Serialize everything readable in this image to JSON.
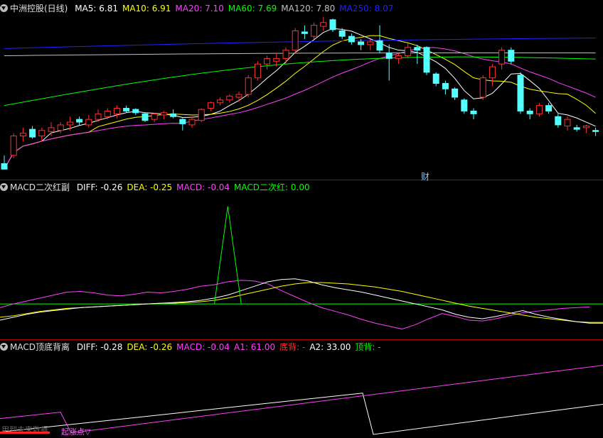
{
  "chart_data": [
    {
      "type": "candlestick",
      "panel": "main",
      "title": "中洲控股(日线)",
      "indicators": [
        {
          "name": "MA5",
          "value": "6.81",
          "color": "#ffffff"
        },
        {
          "name": "MA10",
          "value": "6.91",
          "color": "#ffff00"
        },
        {
          "name": "MA20",
          "value": "7.10",
          "color": "#ff40ff"
        },
        {
          "name": "MA60",
          "value": "7.69",
          "color": "#00ff00"
        },
        {
          "name": "MA120",
          "value": "7.80",
          "color": "#c0c0c0"
        },
        {
          "name": "MA250",
          "value": "8.07",
          "color": "#2020ff"
        }
      ],
      "ylim": [
        5.55,
        8.5
      ],
      "candles": [
        [
          5.8,
          5.95,
          5.7,
          5.7
        ],
        [
          5.95,
          6.35,
          5.9,
          6.3
        ],
        [
          6.3,
          6.45,
          6.2,
          6.35
        ],
        [
          6.42,
          6.48,
          6.25,
          6.28
        ],
        [
          6.3,
          6.45,
          6.2,
          6.4
        ],
        [
          6.38,
          6.55,
          6.3,
          6.45
        ],
        [
          6.4,
          6.55,
          6.35,
          6.5
        ],
        [
          6.5,
          6.65,
          6.4,
          6.55
        ],
        [
          6.6,
          6.65,
          6.5,
          6.55
        ],
        [
          6.5,
          6.68,
          6.45,
          6.6
        ],
        [
          6.6,
          6.78,
          6.55,
          6.7
        ],
        [
          6.65,
          6.8,
          6.6,
          6.75
        ],
        [
          6.7,
          6.85,
          6.62,
          6.8
        ],
        [
          6.8,
          6.85,
          6.72,
          6.75
        ],
        [
          6.78,
          6.8,
          6.68,
          6.72
        ],
        [
          6.7,
          6.72,
          6.55,
          6.58
        ],
        [
          6.6,
          6.72,
          6.55,
          6.7
        ],
        [
          6.68,
          6.75,
          6.6,
          6.72
        ],
        [
          6.7,
          6.78,
          6.62,
          6.65
        ],
        [
          6.6,
          6.62,
          6.4,
          6.52
        ],
        [
          6.5,
          6.65,
          6.45,
          6.6
        ],
        [
          6.58,
          6.8,
          6.55,
          6.78
        ],
        [
          6.8,
          6.92,
          6.75,
          6.9
        ],
        [
          6.9,
          7.0,
          6.85,
          6.95
        ],
        [
          6.95,
          7.05,
          6.9,
          7.02
        ],
        [
          7.0,
          7.1,
          6.92,
          7.05
        ],
        [
          7.05,
          7.4,
          7.0,
          7.35
        ],
        [
          7.35,
          7.65,
          7.3,
          7.6
        ],
        [
          7.6,
          7.75,
          7.5,
          7.7
        ],
        [
          7.65,
          7.8,
          7.55,
          7.7
        ],
        [
          7.7,
          7.9,
          7.6,
          7.85
        ],
        [
          7.85,
          8.25,
          7.8,
          8.2
        ],
        [
          8.18,
          8.3,
          8.05,
          8.15
        ],
        [
          8.1,
          8.35,
          8.05,
          8.3
        ],
        [
          8.28,
          8.45,
          8.2,
          8.35
        ],
        [
          8.4,
          8.42,
          8.18,
          8.22
        ],
        [
          8.2,
          8.25,
          8.05,
          8.1
        ],
        [
          8.1,
          8.15,
          7.95,
          8.0
        ],
        [
          8.0,
          8.05,
          7.85,
          7.95
        ],
        [
          7.95,
          8.05,
          7.85,
          8.0
        ],
        [
          8.02,
          8.3,
          7.8,
          7.85
        ],
        [
          7.8,
          7.95,
          7.3,
          7.7
        ],
        [
          7.7,
          7.8,
          7.6,
          7.75
        ],
        [
          7.75,
          8.0,
          7.7,
          7.9
        ],
        [
          7.9,
          7.95,
          7.6,
          7.85
        ],
        [
          7.9,
          7.92,
          7.4,
          7.45
        ],
        [
          7.42,
          7.45,
          7.2,
          7.25
        ],
        [
          7.25,
          7.3,
          7.05,
          7.15
        ],
        [
          7.15,
          7.18,
          6.95,
          7.0
        ],
        [
          6.95,
          6.98,
          6.7,
          6.75
        ],
        [
          6.75,
          6.8,
          6.6,
          6.7
        ],
        [
          7.0,
          7.4,
          6.95,
          7.35
        ],
        [
          7.35,
          7.6,
          7.2,
          7.55
        ],
        [
          7.6,
          7.9,
          7.5,
          7.85
        ],
        [
          7.85,
          7.9,
          7.6,
          7.65
        ],
        [
          7.4,
          7.45,
          6.7,
          6.75
        ],
        [
          6.75,
          6.8,
          6.6,
          6.7
        ],
        [
          6.7,
          6.9,
          6.65,
          6.85
        ],
        [
          6.85,
          6.9,
          6.7,
          6.75
        ],
        [
          6.65,
          6.7,
          6.45,
          6.5
        ],
        [
          6.48,
          6.65,
          6.4,
          6.6
        ],
        [
          6.45,
          6.5,
          6.38,
          6.42
        ],
        [
          6.45,
          6.5,
          6.35,
          6.48
        ],
        [
          6.4,
          6.45,
          6.3,
          6.38
        ]
      ],
      "annotation": "财"
    },
    {
      "type": "line",
      "panel": "macd1",
      "title": "MACD二次红副",
      "indicators": [
        {
          "name": "DIFF",
          "value": "-0.26",
          "color": "#ffffff"
        },
        {
          "name": "DEA",
          "value": "-0.25",
          "color": "#ffff00"
        },
        {
          "name": "MACD",
          "value": "-0.04",
          "color": "#ff40ff"
        },
        {
          "name": "MACD二次红",
          "value": "0.00",
          "color": "#00ff00"
        }
      ],
      "ylim": [
        -0.45,
        1.5
      ],
      "baseline": 0,
      "diff": [
        -0.22,
        -0.18,
        -0.14,
        -0.11,
        -0.09,
        -0.07,
        -0.05,
        -0.04,
        -0.03,
        -0.02,
        -0.01,
        0.0,
        0.01,
        0.02,
        0.03,
        0.05,
        0.08,
        0.12,
        0.18,
        0.24,
        0.3,
        0.33,
        0.34,
        0.31,
        0.26,
        0.22,
        0.19,
        0.16,
        0.12,
        0.08,
        0.04,
        0.0,
        -0.04,
        -0.08,
        -0.14,
        -0.18,
        -0.2,
        -0.17,
        -0.13,
        -0.09,
        -0.14,
        -0.18,
        -0.21,
        -0.24,
        -0.26,
        -0.26
      ],
      "dea": [
        -0.18,
        -0.16,
        -0.13,
        -0.1,
        -0.08,
        -0.06,
        -0.05,
        -0.04,
        -0.03,
        -0.02,
        -0.01,
        0.0,
        0.01,
        0.01,
        0.02,
        0.03,
        0.05,
        0.08,
        0.12,
        0.16,
        0.2,
        0.24,
        0.27,
        0.29,
        0.29,
        0.28,
        0.27,
        0.25,
        0.23,
        0.2,
        0.17,
        0.13,
        0.09,
        0.05,
        0.01,
        -0.03,
        -0.06,
        -0.09,
        -0.12,
        -0.15,
        -0.18,
        -0.2,
        -0.22,
        -0.24,
        -0.25,
        -0.25
      ],
      "macd": [
        -0.05,
        0.0,
        0.04,
        0.08,
        0.12,
        0.16,
        0.17,
        0.15,
        0.12,
        0.11,
        0.13,
        0.16,
        0.15,
        0.17,
        0.2,
        0.24,
        0.26,
        0.3,
        0.32,
        0.31,
        0.27,
        0.18,
        0.1,
        0.02,
        -0.05,
        -0.1,
        -0.15,
        -0.21,
        -0.26,
        -0.3,
        -0.34,
        -0.28,
        -0.2,
        -0.13,
        -0.17,
        -0.22,
        -0.23,
        -0.2,
        -0.16,
        -0.12,
        -0.1,
        -0.08,
        -0.06,
        -0.05,
        -0.04
      ],
      "spike": {
        "peak_index": 17,
        "peak_value": 1.32
      }
    },
    {
      "type": "line",
      "panel": "macd2",
      "title": "MACD顶底背离",
      "indicators": [
        {
          "name": "DIFF",
          "value": "-0.28",
          "color": "#ffffff"
        },
        {
          "name": "DEA",
          "value": "-0.26",
          "color": "#ffff00"
        },
        {
          "name": "MACD",
          "value": "-0.04",
          "color": "#ff40ff"
        },
        {
          "name": "A1",
          "value": "61.00",
          "color": "#ff40ff"
        },
        {
          "name": "底背",
          "value": "-",
          "color": "#ff3030"
        },
        {
          "name": "A2",
          "value": "33.00",
          "color": "#ffffff"
        },
        {
          "name": "顶背",
          "value": "-",
          "color": "#00ff00"
        }
      ],
      "ylim": [
        0,
        100
      ],
      "white_line": [
        [
          0,
          3
        ],
        [
          510,
          52
        ],
        [
          525,
          0
        ],
        [
          848,
          38
        ]
      ],
      "magenta_line": [
        [
          0,
          20
        ],
        [
          85,
          28
        ],
        [
          100,
          2
        ],
        [
          848,
          87
        ]
      ],
      "warning_text": "用到未来数据",
      "bottom_label": "起涨点▽"
    }
  ]
}
